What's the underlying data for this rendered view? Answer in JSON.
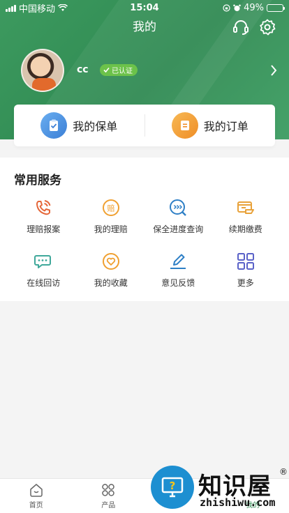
{
  "status_bar": {
    "carrier": "中国移动",
    "time": "15:04",
    "battery": "49%"
  },
  "header": {
    "title": "我的"
  },
  "profile": {
    "username": "cc",
    "badge": "已认证"
  },
  "cards": [
    {
      "label": "我的保单",
      "icon": "clipboard-check-icon",
      "color": "#4a90e2"
    },
    {
      "label": "我的订单",
      "icon": "order-list-icon",
      "color": "#f39c32"
    }
  ],
  "services": {
    "title": "常用服务",
    "items": [
      {
        "label": "理赔报案",
        "icon": "phone-call-icon"
      },
      {
        "label": "我的理赔",
        "icon": "claim-coin-icon"
      },
      {
        "label": "保全进度查询",
        "icon": "progress-search-icon"
      },
      {
        "label": "续期缴费",
        "icon": "payment-card-icon"
      },
      {
        "label": "在线回访",
        "icon": "chat-bubble-icon"
      },
      {
        "label": "我的收藏",
        "icon": "heart-icon"
      },
      {
        "label": "意见反馈",
        "icon": "edit-pen-icon"
      },
      {
        "label": "更多",
        "icon": "grid-more-icon"
      }
    ]
  },
  "tabbar": {
    "items": [
      {
        "label": "首页",
        "active": false
      },
      {
        "label": "产品",
        "active": false
      },
      {
        "label": "",
        "active": false
      },
      {
        "label": "我的",
        "active": true
      }
    ]
  },
  "watermark": {
    "text": "知识屋",
    "sub": "zhishiwu.com",
    "reg": "®"
  },
  "colors": {
    "brand_green": "#2f8a52",
    "accent_orange": "#f39c32",
    "accent_blue": "#4a90e2",
    "verified_green": "#6cc24a"
  }
}
